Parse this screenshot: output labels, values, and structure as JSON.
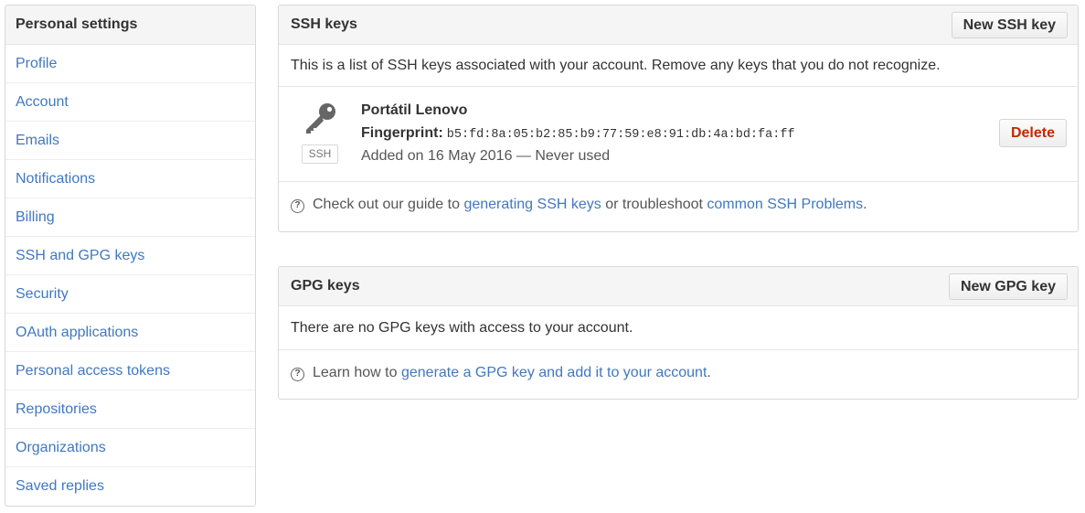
{
  "sidebar": {
    "header": "Personal settings",
    "items": [
      {
        "label": "Profile"
      },
      {
        "label": "Account"
      },
      {
        "label": "Emails"
      },
      {
        "label": "Notifications"
      },
      {
        "label": "Billing"
      },
      {
        "label": "SSH and GPG keys"
      },
      {
        "label": "Security"
      },
      {
        "label": "OAuth applications"
      },
      {
        "label": "Personal access tokens"
      },
      {
        "label": "Repositories"
      },
      {
        "label": "Organizations"
      },
      {
        "label": "Saved replies"
      }
    ]
  },
  "ssh": {
    "title": "SSH keys",
    "new_button": "New SSH key",
    "description": "This is a list of SSH keys associated with your account. Remove any keys that you do not recognize.",
    "key": {
      "icon": "key-icon",
      "badge": "SSH",
      "name": "Portátil Lenovo",
      "fingerprint_label": "Fingerprint:",
      "fingerprint": "b5:fd:8a:05:b2:85:b9:77:59:e8:91:db:4a:bd:fa:ff",
      "added": "Added on 16 May 2016 — Never used",
      "delete_label": "Delete"
    },
    "help": {
      "icon": "question-circle-icon",
      "prefix": "Check out our guide to",
      "link1": "generating SSH keys",
      "middle": "or troubleshoot",
      "link2": "common SSH Problems",
      "suffix": "."
    }
  },
  "gpg": {
    "title": "GPG keys",
    "new_button": "New GPG key",
    "description": "There are no GPG keys with access to your account.",
    "help": {
      "icon": "question-circle-icon",
      "prefix": "Learn how to",
      "link": "generate a GPG key and add it to your account",
      "suffix": "."
    }
  },
  "colors": {
    "link": "#4078c0",
    "danger": "#bd2c00",
    "header_bg": "#f5f5f5",
    "border": "#d8d8d8"
  }
}
